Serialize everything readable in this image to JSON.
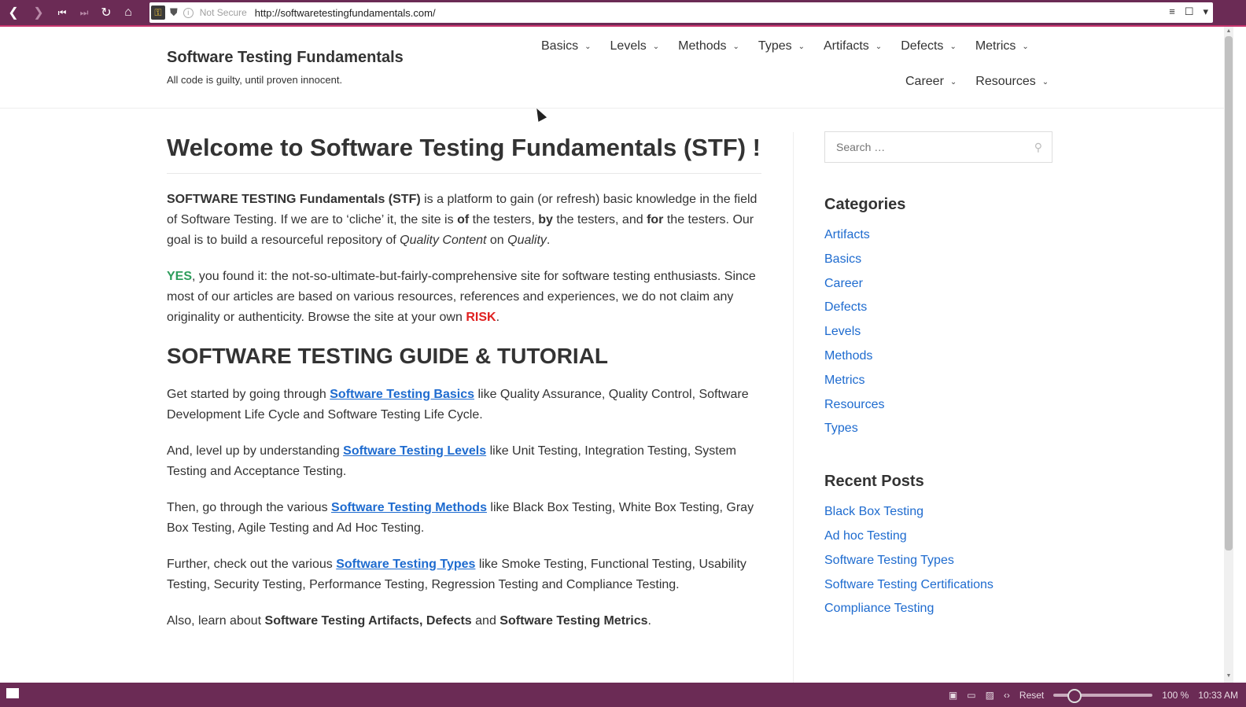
{
  "browser": {
    "security_label": "Not Secure",
    "url": "http://softwaretestingfundamentals.com/",
    "zoom_reset": "Reset",
    "zoom_level": "100 %",
    "time": "10:33 AM"
  },
  "site": {
    "title": "Software Testing Fundamentals",
    "tagline": "All code is guilty, until proven innocent."
  },
  "nav": {
    "row1": [
      "Basics",
      "Levels",
      "Methods",
      "Types",
      "Artifacts",
      "Defects",
      "Metrics"
    ],
    "row2": [
      "Career",
      "Resources"
    ]
  },
  "main": {
    "h1": "Welcome to Software Testing Fundamentals (STF) !",
    "p1_strong": "SOFTWARE TESTING Fundamentals (STF)",
    "p1_a": " is a platform to gain (or refresh) basic knowledge in the field of Software Testing. If we are to ‘cliche’ it, the site is ",
    "p1_of": "of",
    "p1_b": " the testers, ",
    "p1_by": "by",
    "p1_c": " the testers, and ",
    "p1_for": "for",
    "p1_d": " the testers. Our goal is to build a resourceful repository of ",
    "p1_qc": "Quality Content",
    "p1_e": " on ",
    "p1_q": "Quality",
    "p1_f": ".",
    "p2_yes": "YES",
    "p2_a": ", you found it: the not-so-ultimate-but-fairly-comprehensive site for software testing enthusiasts. Since most of our articles are based on various resources, references and experiences, we do not claim any originality or authenticity. Browse the site at your own ",
    "p2_risk": "RISK",
    "p2_b": ".",
    "h2": "SOFTWARE TESTING GUIDE & TUTORIAL",
    "g1_a": "Get started by going through ",
    "g1_link": "Software Testing Basics",
    "g1_b": " like Quality Assurance, Quality Control, Software Development Life Cycle and Software Testing Life Cycle.",
    "g2_a": "And, level up by understanding ",
    "g2_link": "Software Testing Levels",
    "g2_b": " like Unit Testing, Integration Testing, System Testing and Acceptance Testing.",
    "g3_a": "Then, go through the various ",
    "g3_link": "Software Testing Methods",
    "g3_b": " like Black Box Testing, White Box Testing, Gray Box Testing, Agile Testing and Ad Hoc Testing.",
    "g4_a": "Further, check out the various ",
    "g4_link": "Software Testing Types",
    "g4_b": " like Smoke Testing, Functional Testing, Usability Testing, Security Testing, Performance Testing, Regression Testing and Compliance Testing.",
    "g5_a": "Also, learn about ",
    "g5_s1": "Software Testing Artifacts, Defects",
    "g5_b": " and ",
    "g5_s2": "Software Testing Metrics",
    "g5_c": "."
  },
  "sidebar": {
    "search_placeholder": "Search …",
    "categories_title": "Categories",
    "categories": [
      "Artifacts",
      "Basics",
      "Career",
      "Defects",
      "Levels",
      "Methods",
      "Metrics",
      "Resources",
      "Types"
    ],
    "recent_title": "Recent Posts",
    "recent": [
      "Black Box Testing",
      "Ad hoc Testing",
      "Software Testing Types",
      "Software Testing Certifications",
      "Compliance Testing"
    ]
  }
}
